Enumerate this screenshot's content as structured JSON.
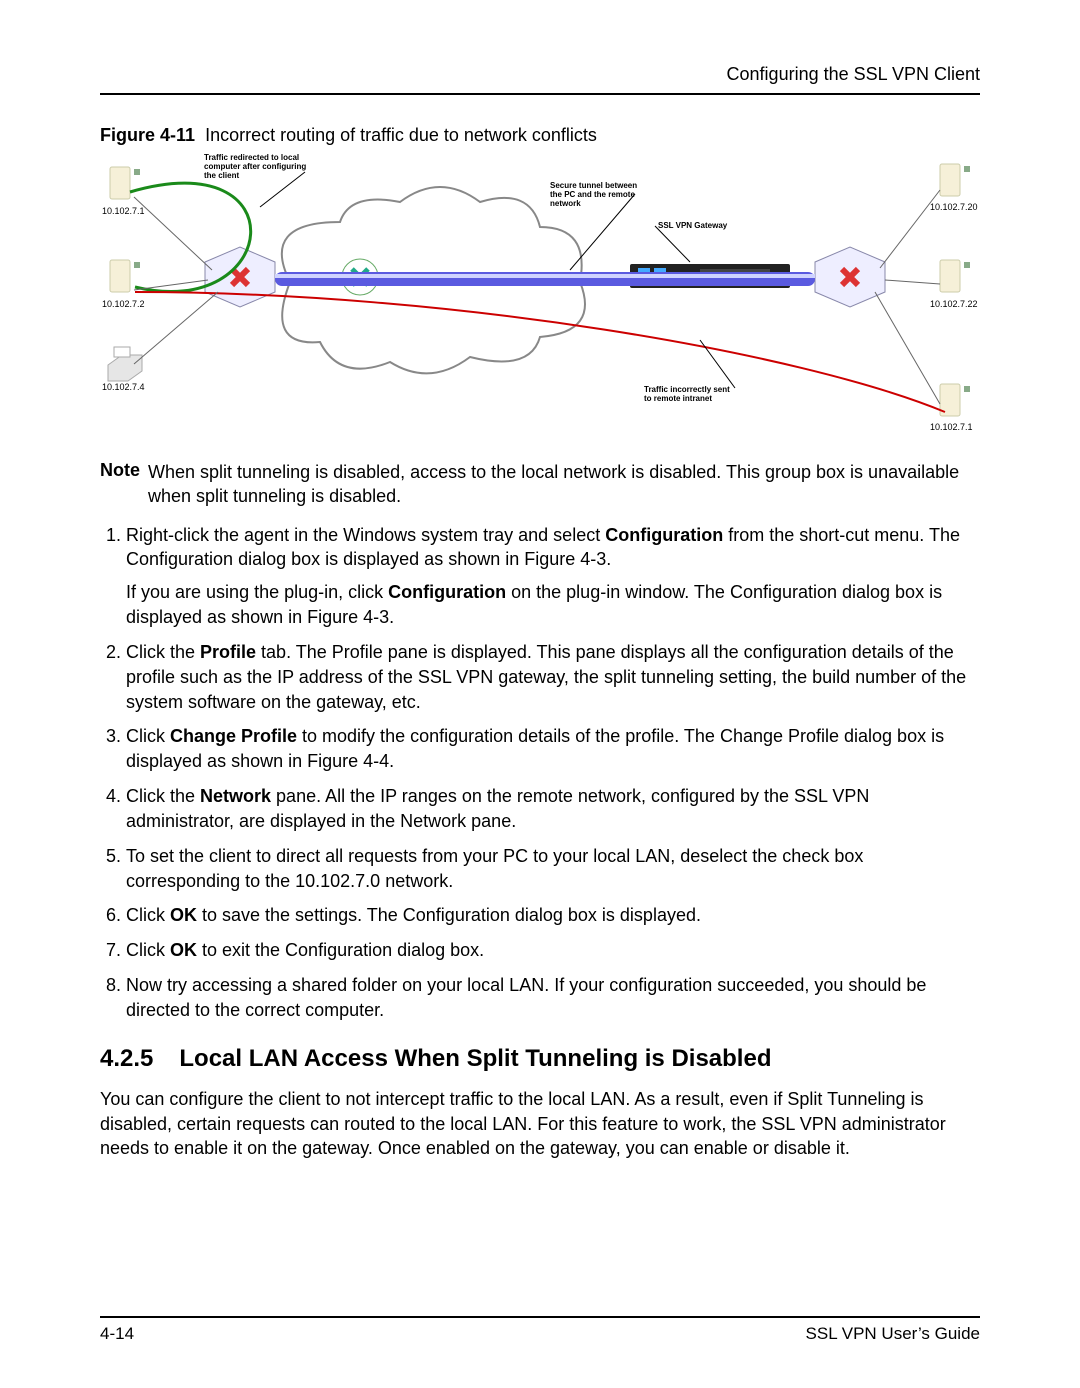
{
  "header": {
    "running": "Configuring the SSL VPN Client"
  },
  "figure": {
    "label": "Figure 4-11",
    "caption": "Incorrect routing of traffic due to network conflicts",
    "annotations": {
      "redirect": "Traffic redirected to local computer after configuring the client",
      "tunnel": "Secure tunnel between the PC and the remote network",
      "gateway": "SSL VPN Gateway",
      "wrong": "Traffic incorrectly sent to remote intranet"
    },
    "ips": {
      "pc1": "10.102.7.1",
      "pc2": "10.102.7.2",
      "printer": "10.102.7.4",
      "r1": "10.102.7.20",
      "r2": "10.102.7.22",
      "r3": "10.102.7.1"
    }
  },
  "note": {
    "label": "Note",
    "text": "When split tunneling is disabled, access to the local network is disabled. This group box is unavailable when split tunneling is disabled."
  },
  "steps": [
    {
      "seg": [
        "Right-click the agent in the Windows system tray and select ",
        "Configuration",
        " from the short-cut menu. The Configuration dialog box is displayed as shown in Figure 4-3."
      ],
      "para_seg": [
        "If you are using the plug-in, click ",
        "Configuration",
        " on the plug-in window. The Configuration dialog box is displayed as shown in Figure 4-3."
      ]
    },
    {
      "seg": [
        "Click the ",
        "Profile",
        " tab. The Profile pane is displayed. This pane displays all the configuration details of the profile such as the IP address of the SSL VPN gateway, the split tunneling setting, the build number of the system software on the gateway, etc."
      ]
    },
    {
      "seg": [
        "Click ",
        "Change Profile",
        " to modify the configuration details of the profile. The Change Profile dialog box is displayed as shown in Figure 4-4."
      ]
    },
    {
      "seg": [
        "Click the ",
        "Network",
        " pane. All the IP ranges on the remote network, configured by the SSL VPN administrator, are displayed in the Network pane."
      ]
    },
    {
      "seg": [
        "To set the client to direct all requests from your PC to your local LAN, deselect the check box corresponding to the 10.102.7.0 network."
      ]
    },
    {
      "seg": [
        "Click ",
        "OK",
        " to save the settings. The Configuration dialog box is displayed."
      ]
    },
    {
      "seg": [
        "Click ",
        "OK",
        " to exit the Configuration dialog box."
      ]
    },
    {
      "seg": [
        "Now try accessing a shared folder on your local LAN. If your configuration succeeded, you should be directed to the correct computer."
      ]
    }
  ],
  "section": {
    "number": "4.2.5",
    "title": "Local LAN Access When Split Tunneling is Disabled",
    "body": "You can configure the client to not intercept traffic to the local LAN. As a result, even if Split Tunneling is disabled, certain requests can routed to the local LAN. For this feature to work, the SSL VPN administrator needs to enable it on the gateway. Once enabled on the gateway, you can enable or disable it."
  },
  "footer": {
    "left": "4-14",
    "right": "SSL VPN User’s Guide"
  }
}
